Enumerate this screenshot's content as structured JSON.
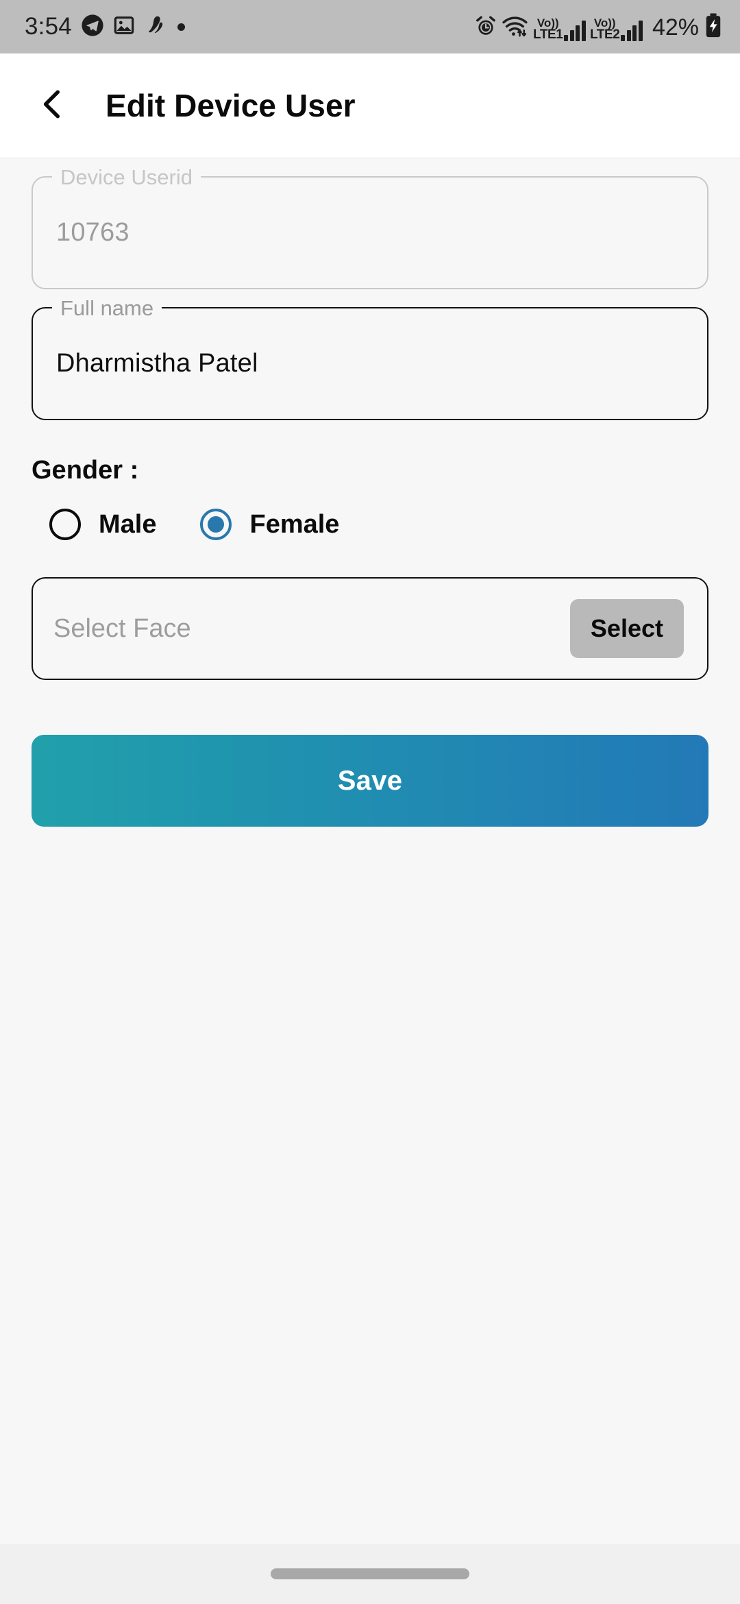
{
  "status_bar": {
    "time": "3:54",
    "left_icons": [
      "telegram-icon",
      "photos-icon",
      "app-icon",
      "dot-icon"
    ],
    "alarm_icon": "alarm-icon",
    "wifi_icon": "wifi-icon",
    "sim1_label_top": "Vo))",
    "sim1_label_bottom": "LTE1",
    "sim2_label_top": "Vo))",
    "sim2_label_bottom": "LTE2",
    "battery_percent": "42%",
    "battery_icon": "battery-charging-icon",
    "background_color": "#bdbdbd"
  },
  "app_bar": {
    "back_icon": "chevron-left-icon",
    "title": "Edit Device User"
  },
  "form": {
    "device_userid": {
      "label": "Device Userid",
      "value": "10763",
      "disabled": true
    },
    "full_name": {
      "label": "Full name",
      "value": "Dharmistha Patel",
      "disabled": false
    },
    "gender": {
      "label": "Gender :",
      "options": [
        {
          "label": "Male",
          "selected": false
        },
        {
          "label": "Female",
          "selected": true
        }
      ],
      "selected_color": "#2878ad"
    },
    "select_face": {
      "placeholder": "Select Face",
      "button_label": "Select",
      "button_color": "#b9b9b9"
    },
    "save_button": {
      "label": "Save",
      "gradient_start": "#21a0ab",
      "gradient_end": "#2379b7"
    }
  },
  "nav_bar": {
    "handle": "home-gesture-pill"
  }
}
